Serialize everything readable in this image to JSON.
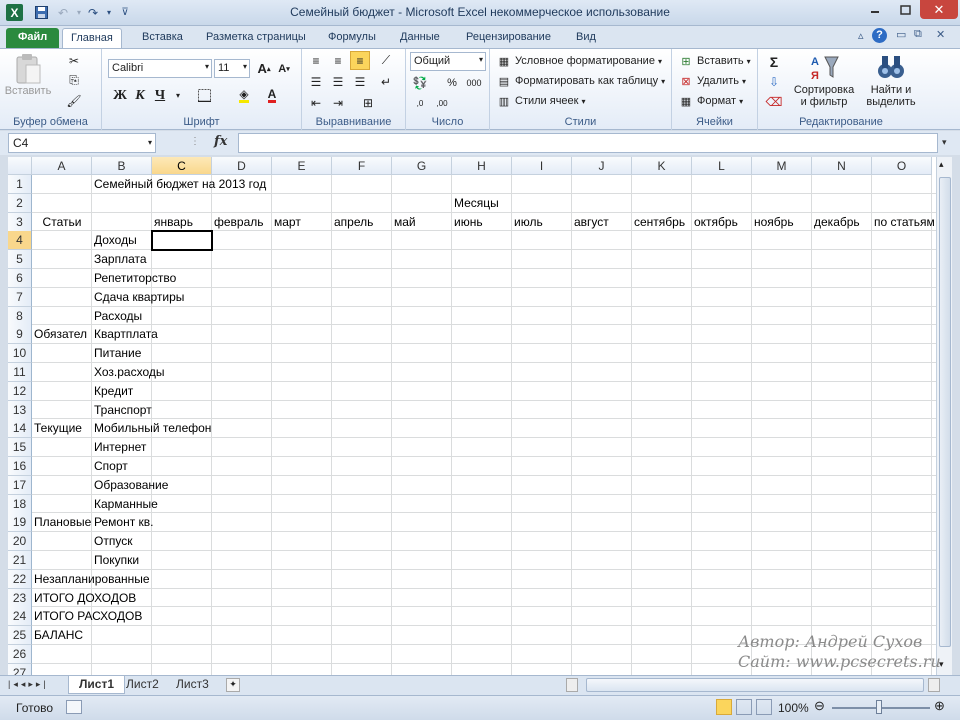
{
  "window": {
    "title": "Семейный бюджет - Microsoft Excel некоммерческое использование",
    "app_icon": "X"
  },
  "ribbon_tabs": [
    {
      "label": "Файл",
      "kind": "file"
    },
    {
      "label": "Главная",
      "kind": "active"
    },
    {
      "label": "Вставка"
    },
    {
      "label": "Разметка страницы"
    },
    {
      "label": "Формулы"
    },
    {
      "label": "Данные"
    },
    {
      "label": "Рецензирование"
    },
    {
      "label": "Вид"
    }
  ],
  "ribbon": {
    "clipboard": {
      "paste_label": "Вставить",
      "group_label": "Буфер обмена"
    },
    "font": {
      "font_name": "Calibri",
      "font_size": "11",
      "bold": "Ж",
      "italic": "К",
      "underline": "Ч",
      "group_label": "Шрифт"
    },
    "alignment": {
      "group_label": "Выравнивание"
    },
    "number": {
      "format": "Общий",
      "group_label": "Число"
    },
    "styles": {
      "conditional": "Условное форматирование",
      "as_table": "Форматировать как таблицу",
      "cell_styles": "Стили ячеек",
      "group_label": "Стили"
    },
    "cells": {
      "insert": "Вставить",
      "delete": "Удалить",
      "format": "Формат",
      "group_label": "Ячейки"
    },
    "editing": {
      "sort_line1": "Сортировка",
      "sort_line2": "и фильтр",
      "find_line1": "Найти и",
      "find_line2": "выделить",
      "group_label": "Редактирование"
    }
  },
  "formula_bar": {
    "name_box": "C4",
    "fx": "fx",
    "formula": ""
  },
  "columns": [
    "A",
    "B",
    "C",
    "D",
    "E",
    "F",
    "G",
    "H",
    "I",
    "J",
    "K",
    "L",
    "M",
    "N",
    "O"
  ],
  "rows": [
    "1",
    "2",
    "3",
    "4",
    "5",
    "6",
    "7",
    "8",
    "9",
    "10",
    "11",
    "12",
    "13",
    "14",
    "15",
    "16",
    "17",
    "18",
    "19",
    "20",
    "21",
    "22",
    "23",
    "24",
    "25",
    "26",
    "27"
  ],
  "cells": {
    "B1": "Семейный бюджет на 2013 год",
    "H2": "Месяцы",
    "A3": "Статьи",
    "C3": "январь",
    "D3": "февраль",
    "E3": "март",
    "F3": "апрель",
    "G3": "май",
    "H3": "июнь",
    "I3": "июль",
    "J3": "август",
    "K3": "сентябрь",
    "L3": "октябрь",
    "M3": "ноябрь",
    "N3": "декабрь",
    "O3": "по статьям",
    "B4": "Доходы",
    "B5": "Зарплата",
    "B6": "Репетиторство",
    "B7": "Сдача квартиры",
    "B8": "Расходы",
    "A9": "Обязател",
    "B9": "Квартплата",
    "B10": "Питание",
    "B11": "Хоз.расходы",
    "B12": "Кредит",
    "B13": "Транспорт",
    "A14": "Текущие",
    "B14": "Мобильный телефон",
    "B15": "Интернет",
    "B16": "Спорт",
    "B17": "Образование",
    "B18": "Карманные",
    "A19": "Плановые",
    "B19": "Ремонт кв.",
    "B20": "Отпуск",
    "B21": "Покупки",
    "A22": "Незапланированные",
    "A23": "ИТОГО ДОХОДОВ",
    "A24": "ИТОГО РАСХОДОВ",
    "A25": "БАЛАНС"
  },
  "sheets": [
    "Лист1",
    "Лист2",
    "Лист3"
  ],
  "active_sheet": "Лист1",
  "status": {
    "ready": "Готово",
    "zoom": "100%"
  },
  "watermark": {
    "line1": "Автор: Андрей Сухов",
    "line2": "Сайт: www.pcsecrets.ru"
  },
  "colors": {
    "selection_header": "#f9d78c",
    "file_tab": "#2a8a3e"
  }
}
